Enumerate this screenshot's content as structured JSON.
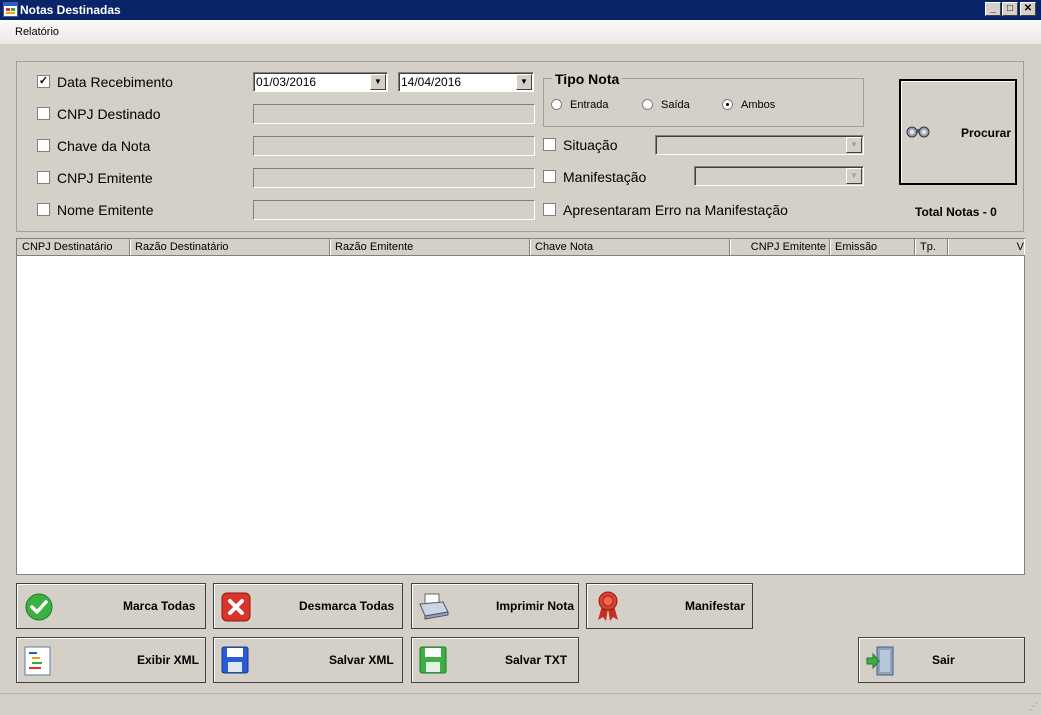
{
  "window": {
    "title": "Notas Destinadas"
  },
  "menu": {
    "items": [
      {
        "label": "Relatório"
      }
    ]
  },
  "filters": {
    "data_recebimento": {
      "label": "Data Recebimento",
      "checked": true,
      "from": "01/03/2016",
      "to": "14/04/2016"
    },
    "cnpj_destinado": {
      "label": "CNPJ Destinado",
      "checked": false
    },
    "chave_nota": {
      "label": "Chave da Nota",
      "checked": false
    },
    "cnpj_emitente": {
      "label": "CNPJ Emitente",
      "checked": false
    },
    "nome_emitente": {
      "label": "Nome Emitente",
      "checked": false
    },
    "situacao": {
      "label": "Situação",
      "checked": false
    },
    "manifestacao": {
      "label": "Manifestação",
      "checked": false
    },
    "erro_manifestacao": {
      "label": "Apresentaram Erro na Manifestação",
      "checked": false
    }
  },
  "tipo_nota": {
    "title": "Tipo Nota",
    "options": [
      {
        "label": "Entrada"
      },
      {
        "label": "Saída"
      },
      {
        "label": "Ambos"
      }
    ],
    "selected": "Ambos"
  },
  "search": {
    "label": "Procurar"
  },
  "total": {
    "label": "Total Notas - 0"
  },
  "table": {
    "columns": [
      {
        "label": "CNPJ Destinatário"
      },
      {
        "label": "Razão Destinatário"
      },
      {
        "label": "Razão Emitente"
      },
      {
        "label": "Chave Nota"
      },
      {
        "label": "CNPJ Emitente"
      },
      {
        "label": "Emissão"
      },
      {
        "label": "Tp."
      },
      {
        "label": "V"
      }
    ],
    "rows": []
  },
  "actions": {
    "marca_todas": "Marca Todas",
    "desmarca_todas": "Desmarca Todas",
    "imprimir_nota": "Imprimir Nota",
    "manifestar": "Manifestar",
    "exibir_xml": "Exibir XML",
    "salvar_xml": "Salvar XML",
    "salvar_txt": "Salvar TXT",
    "sair": "Sair"
  },
  "icons": {
    "app": "form-icon",
    "search": "binoculars-icon",
    "marca_todas": "check-circle-icon",
    "desmarca_todas": "x-mark-icon",
    "imprimir": "printer-icon",
    "manifestar": "ribbon-award-icon",
    "exibir_xml": "document-tree-icon",
    "salvar_xml": "floppy-disk-blue-icon",
    "salvar_txt": "floppy-disk-green-icon",
    "sair": "exit-door-icon"
  },
  "colors": {
    "title_bar": "#0a246a",
    "window_bg": "#d4d0c8",
    "check_green": "#3cb043",
    "error_red": "#d9342b"
  }
}
